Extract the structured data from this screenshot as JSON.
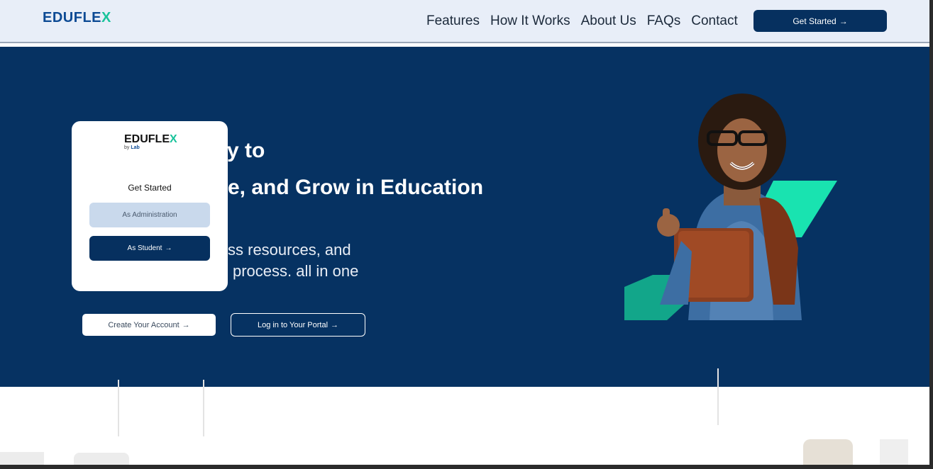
{
  "brand": {
    "name_main": "EDUFLE",
    "name_x": "X"
  },
  "nav": {
    "links": [
      "Features",
      "How It Works",
      "About Us",
      "FAQs",
      "Contact"
    ],
    "cta_label": "Get Started"
  },
  "hero": {
    "title_line1": "y to",
    "title_line2": "e, and Grow in Education",
    "sub_line1": "ss resources, and",
    "sub_line2": "process. all in one",
    "btn_create": "Create Your Account",
    "btn_login": "Log in to Your Portal"
  },
  "modal": {
    "logo_main": "EDUFLE",
    "logo_x": "X",
    "by": "by",
    "lab": "Lab",
    "title": "Get Started",
    "admin_label": "As Administration",
    "student_label": "As Student"
  },
  "icons": {
    "arrow": "→"
  },
  "colors": {
    "navy": "#063262",
    "accent": "#19c39b",
    "nav_bg": "#e8eef8"
  }
}
